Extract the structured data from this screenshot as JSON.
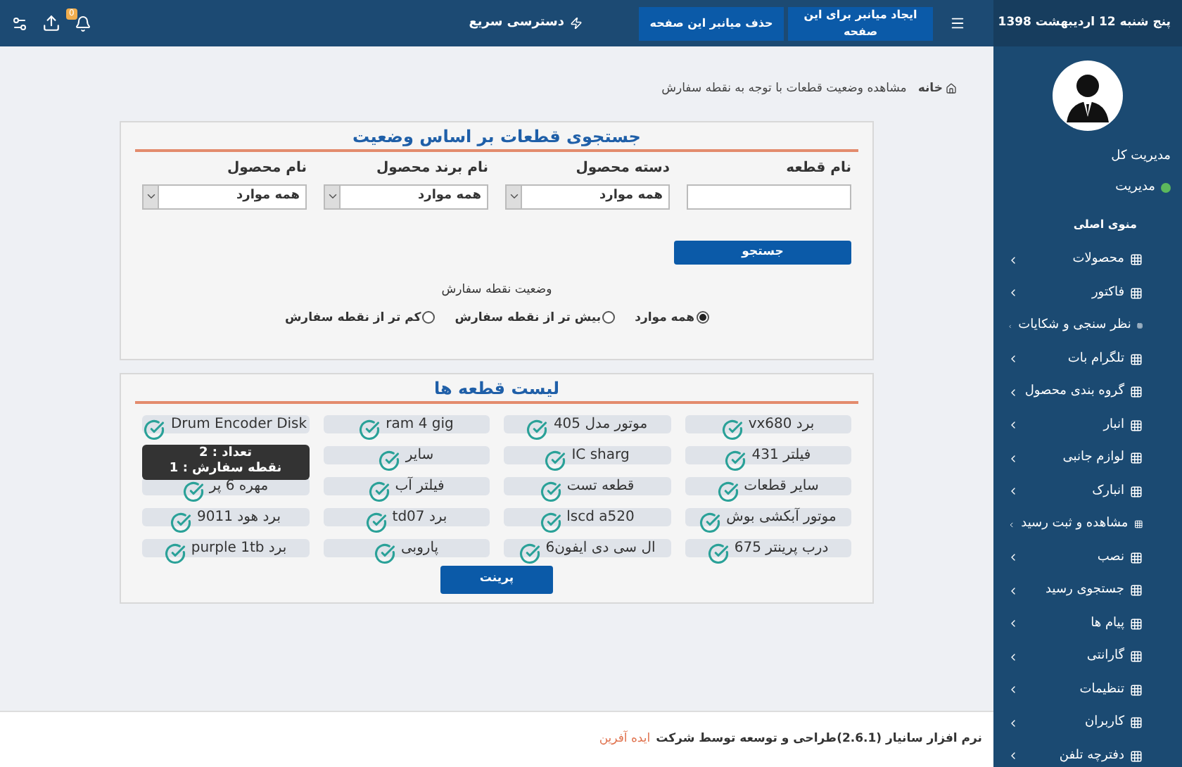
{
  "topbar": {
    "date": "پنج شنبه 12 اردیبهشت 1398",
    "buttons": [
      "ایجاد میانبر برای این صفحه",
      "حذف میانبر این صفحه"
    ],
    "quick_access": "دسترسی سریع",
    "notification_count": "0"
  },
  "sidebar": {
    "role_title": "مدیریت کل",
    "user": "مدیریت",
    "online": true,
    "menu_title": "منوی اصلی",
    "items": [
      "محصولات",
      "فاکتور",
      "نظر سنجی و شکایات",
      "تلگرام بات",
      "گروه بندی محصول",
      "انبار",
      "لوازم جانبی",
      "انبارک",
      "مشاهده و ثبت رسید",
      "نصب",
      "جستجوی رسید",
      "پیام ها",
      "گارانتی",
      "تنظیمات",
      "کاربران",
      "دفترچه تلفن"
    ]
  },
  "breadcrumb": [
    {
      "label": "خانه",
      "kind": "home"
    },
    {
      "label": "مشاهده وضعیت قطعات با توجه به نقطه سفارش",
      "kind": "page"
    }
  ],
  "search_card": {
    "title": "جستجوی قطعات بر اساس وضعیت",
    "fields": [
      {
        "label": "نام قطعه",
        "kind": "text"
      },
      {
        "label": "دسته محصول",
        "kind": "select",
        "value": "همه موارد"
      },
      {
        "label": "نام برند محصول",
        "kind": "select",
        "value": "همه موارد"
      },
      {
        "label": "نام محصول",
        "kind": "select",
        "value": "همه موارد"
      }
    ],
    "search_button": "جستجو",
    "status_label": "وضعیت نقطه سفارش",
    "options": [
      {
        "label": "همه موارد",
        "selected": true
      },
      {
        "label": "بیش تر از نقطه سفارش",
        "selected": false
      },
      {
        "label": "کم تر از نقطه سفارش",
        "selected": false
      }
    ]
  },
  "list_card": {
    "title": "لیست قطعه ها",
    "print_button": "پرینت",
    "items": [
      {
        "kind": "part",
        "name": "برد vx680"
      },
      {
        "kind": "part",
        "name": "موتور مدل 405"
      },
      {
        "kind": "part",
        "name": "ram 4 gig"
      },
      {
        "kind": "part",
        "name": "Drum Encoder Disk"
      },
      {
        "kind": "part",
        "name": "فیلتر 431"
      },
      {
        "kind": "part",
        "name": "IC sharg"
      },
      {
        "kind": "part",
        "name": "سایر"
      },
      {
        "kind": "tooltip",
        "lines": [
          "تعداد : 2",
          "نقطه سفارش : 1"
        ]
      },
      {
        "kind": "part",
        "name": "سایر قطعات"
      },
      {
        "kind": "part",
        "name": "قطعه تست"
      },
      {
        "kind": "part",
        "name": "فیلتر آب"
      },
      {
        "kind": "part",
        "name": "مهره 6 پر"
      },
      {
        "kind": "part",
        "name": "موتور آبکشی بوش"
      },
      {
        "kind": "part",
        "name": "lscd a520"
      },
      {
        "kind": "part",
        "name": "برد td07"
      },
      {
        "kind": "part",
        "name": "برد هود 9011"
      },
      {
        "kind": "part",
        "name": "درب پرینتر 675"
      },
      {
        "kind": "part",
        "name": "ال سی دی ایفون6"
      },
      {
        "kind": "part",
        "name": "پاروبی"
      },
      {
        "kind": "part",
        "name": "برد purple 1tb"
      }
    ]
  },
  "footer": {
    "text": "نرم افزار سانیار (2.6.1)طراحی و توسعه توسط شرکت",
    "company": "ایده آفرین"
  }
}
